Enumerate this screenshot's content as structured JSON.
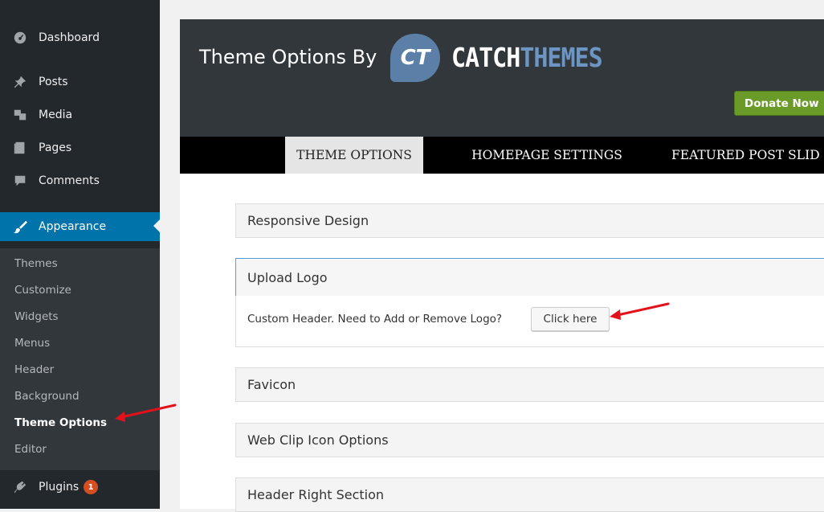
{
  "sidebar": {
    "items": [
      {
        "label": "Dashboard",
        "icon": "dashboard-icon"
      },
      {
        "label": "Posts",
        "icon": "pin-icon"
      },
      {
        "label": "Media",
        "icon": "media-icon"
      },
      {
        "label": "Pages",
        "icon": "pages-icon"
      },
      {
        "label": "Comments",
        "icon": "comment-icon"
      },
      {
        "label": "Appearance",
        "icon": "brush-icon"
      }
    ],
    "submenu": [
      "Themes",
      "Customize",
      "Widgets",
      "Menus",
      "Header",
      "Background",
      "Theme Options",
      "Editor"
    ],
    "plugins": {
      "label": "Plugins",
      "icon": "plug-icon",
      "badge": "1"
    },
    "colors": {
      "background": "#23282d",
      "active": "#0073aa",
      "submenu_bg": "#32373c"
    }
  },
  "header": {
    "title": "Theme Options By",
    "logo_mark": "CT",
    "logo_text_1": "CATCH",
    "logo_text_2": "THEMES",
    "donate_label": "Donate Now"
  },
  "tabs": [
    {
      "label": "THEME OPTIONS",
      "active": true
    },
    {
      "label": "HOMEPAGE SETTINGS",
      "active": false
    },
    {
      "label": "FEATURED POST SLID",
      "active": false
    }
  ],
  "sections": [
    {
      "label": "Responsive Design"
    },
    {
      "label": "Upload Logo",
      "open": true
    },
    {
      "label": "Favicon"
    },
    {
      "label": "Web Clip Icon Options"
    },
    {
      "label": "Header Right Section"
    }
  ],
  "upload_logo": {
    "text": "Custom Header. Need to Add or Remove Logo?",
    "button_label": "Click here"
  },
  "annotation_color": "#e3111b"
}
